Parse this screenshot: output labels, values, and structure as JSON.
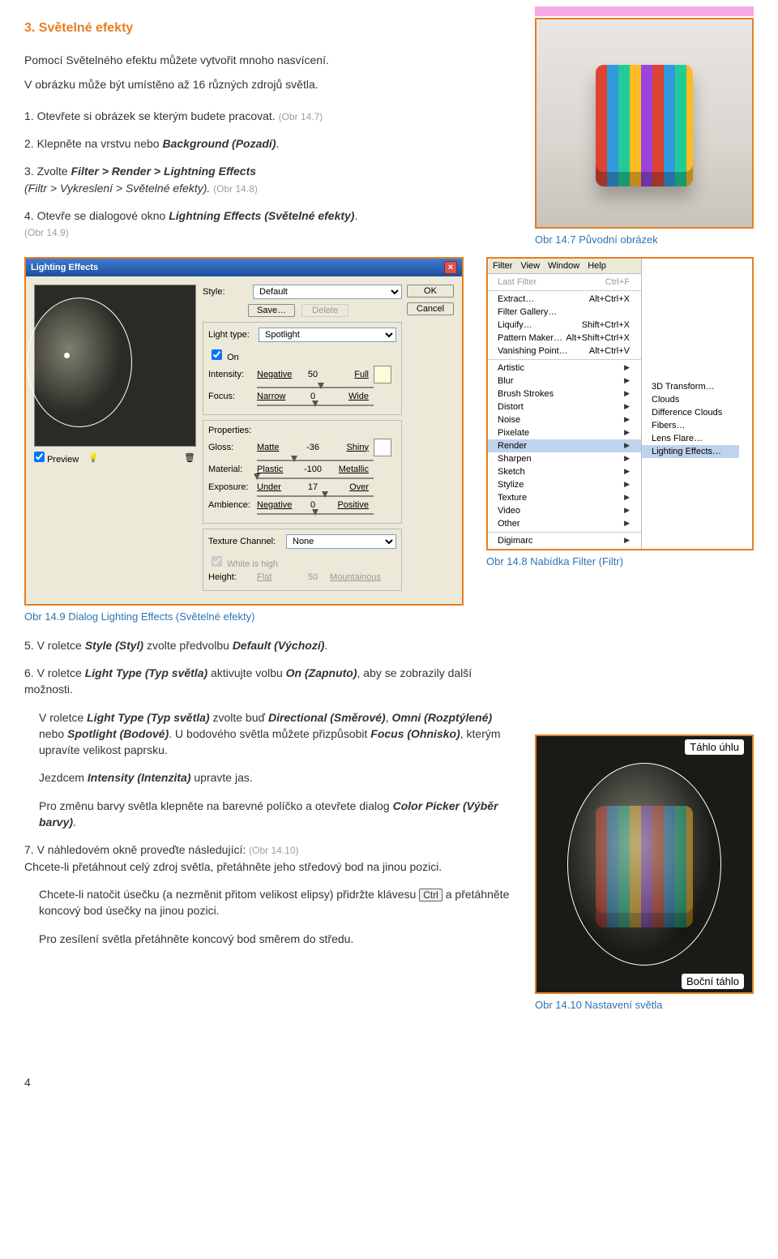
{
  "section": {
    "title": "3. Světelné efekty"
  },
  "intro": {
    "p1": "Pomocí Světelného efektu můžete vytvořit mnoho nasvícení.",
    "p2": "V obrázku může být umístěno až 16 různých zdrojů světla."
  },
  "steps": {
    "s1": {
      "num": "1.",
      "text": "Otevřete si obrázek se kterým budete pracovat.",
      "ref": "(Obr 14.7)"
    },
    "s2": {
      "num": "2.",
      "text_a": "Klepněte na vrstvu nebo ",
      "text_b": "Background (Pozadí)",
      "text_c": "."
    },
    "s3": {
      "num": "3.",
      "text_a": "Zvolte ",
      "text_b": "Filter > Render > Lightning Effects",
      "text_c": " (Filtr > Vykreslení > Světelné efekty).",
      "ref": "(Obr 14.8)"
    },
    "s4": {
      "num": "4.",
      "text_a": "Otevře se dialogové okno ",
      "text_b": "Lightning Effects (Světelné efekty)",
      "text_c": ".",
      "ref": "(Obr 14.9)"
    },
    "s5": {
      "num": "5.",
      "text_a": "V roletce ",
      "text_b": "Style (Styl)",
      "text_c": " zvolte předvolbu ",
      "text_d": "Default (Výchozí)",
      "text_e": "."
    },
    "s6": {
      "num": "6.",
      "text_a": "V roletce ",
      "text_b": "Light Type (Typ světla)",
      "text_c": " aktivujte volbu ",
      "text_d": "On (Zapnuto)",
      "text_e": ", aby se zobrazily další možnosti."
    },
    "s6b": {
      "text_a": "V roletce ",
      "text_b": "Light Type (Typ světla)",
      "text_c": " zvolte buď ",
      "text_d": "Directional (Směrové)",
      "text_e": ", ",
      "text_f": "Omni (Rozptýlené)",
      "text_g": " nebo ",
      "text_h": "Spotlight (Bodové)",
      "text_i": ". U bodového světla můžete přizpůsobit ",
      "text_j": "Focus (Ohnisko)",
      "text_k": ", kterým upravíte velikost paprsku."
    },
    "s6c": {
      "text_a": "Jezdcem ",
      "text_b": "Intensity (Intenzita)",
      "text_c": " upravte jas."
    },
    "s6d": {
      "text_a": "Pro změnu barvy světla klepněte na barevné políčko a otevřete dialog ",
      "text_b": "Color Picker (Výběr barvy)",
      "text_c": "."
    },
    "s7": {
      "num": "7.",
      "text_a": "V náhledovém okně proveďte následující:",
      "ref": "(Obr 14.10)",
      "text_b": "Chcete-li přetáhnout celý zdroj světla, přetáhněte jeho středový bod na jinou pozici."
    },
    "s7b": {
      "text_a": "Chcete-li natočit úsečku (a nezměnit přitom velikost elipsy) přidržte klávesu ",
      "key": "Ctrl",
      "text_b": " a přetáhněte koncový bod úsečky na jinou pozici."
    },
    "s7c": {
      "text": "Pro zesílení světla přetáhněte koncový bod směrem do středu."
    }
  },
  "captions": {
    "c147": "Obr 14.7   Původní obrázek",
    "c148": "Obr 14.8   Nabídka Filter (Filtr)",
    "c149": "Obr 14.9   Dialog Lighting Effects (Světelné efekty)",
    "c1410": "Obr 14.10   Nastavení světla"
  },
  "dialog": {
    "title": "Lighting Effects",
    "close": "×",
    "style_label": "Style:",
    "style_value": "Default",
    "save": "Save…",
    "delete": "Delete",
    "ok": "OK",
    "cancel": "Cancel",
    "light_type_label": "Light type:",
    "light_type_value": "Spotlight",
    "on": "On",
    "intensity_label": "Intensity:",
    "intensity_a": "Negative",
    "intensity_val": "50",
    "intensity_b": "Full",
    "focus_label": "Focus:",
    "focus_a": "Narrow",
    "focus_val": "0",
    "focus_b": "Wide",
    "properties": "Properties:",
    "gloss_label": "Gloss:",
    "gloss_a": "Matte",
    "gloss_val": "-36",
    "gloss_b": "Shiny",
    "material_label": "Material:",
    "material_a": "Plastic",
    "material_val": "-100",
    "material_b": "Metallic",
    "exposure_label": "Exposure:",
    "exposure_a": "Under",
    "exposure_val": "17",
    "exposure_b": "Over",
    "ambience_label": "Ambience:",
    "ambience_a": "Negative",
    "ambience_val": "0",
    "ambience_b": "Positive",
    "tex_label": "Texture Channel:",
    "tex_value": "None",
    "white": "White is high",
    "height_label": "Height:",
    "height_a": "Flat",
    "height_val": "50",
    "height_b": "Mountainous",
    "preview": "Preview",
    "bulb": "💡",
    "trash": "🗑"
  },
  "menu": {
    "bar": [
      "Filter",
      "View",
      "Window",
      "Help"
    ],
    "last": {
      "label": "Last Filter",
      "short": "Ctrl+F"
    },
    "items1": [
      {
        "label": "Extract…",
        "short": "Alt+Ctrl+X"
      },
      {
        "label": "Filter Gallery…",
        "short": ""
      },
      {
        "label": "Liquify…",
        "short": "Shift+Ctrl+X"
      },
      {
        "label": "Pattern Maker…",
        "short": "Alt+Shift+Ctrl+X"
      },
      {
        "label": "Vanishing Point…",
        "short": "Alt+Ctrl+V"
      }
    ],
    "groups": [
      "Artistic",
      "Blur",
      "Brush Strokes",
      "Distort",
      "Noise",
      "Pixelate",
      "Render",
      "Sharpen",
      "Sketch",
      "Stylize",
      "Texture",
      "Video",
      "Other"
    ],
    "digimarc": "Digimarc",
    "sub": [
      "3D Transform…",
      "Clouds",
      "Difference Clouds",
      "Fibers…",
      "Lens Flare…",
      "Lighting Effects…"
    ]
  },
  "preview_labels": {
    "top": "Táhlo úhlu",
    "bottom": "Boční táhlo"
  },
  "page": "4"
}
